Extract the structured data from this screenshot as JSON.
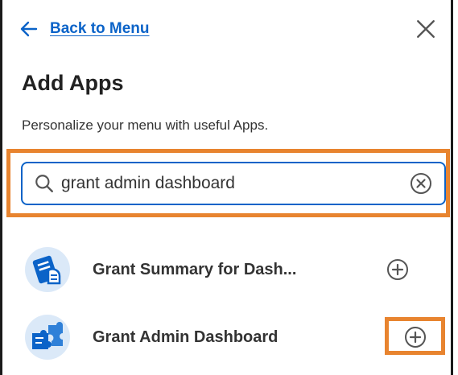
{
  "header": {
    "back_label": "Back to Menu",
    "back_icon": "arrow-left-icon",
    "close_icon": "close-icon"
  },
  "title": "Add Apps",
  "subtitle": "Personalize your menu with useful Apps.",
  "search": {
    "value": "grant admin dashboard",
    "icon": "search-icon",
    "clear_icon": "clear-circle-x-icon"
  },
  "apps": [
    {
      "label": "Grant Summary for Dash...",
      "icon": "hand-document-icon",
      "action_icon": "add-circle-icon"
    },
    {
      "label": "Grant Admin Dashboard",
      "icon": "puzzle-pieces-icon",
      "action_icon": "add-circle-icon"
    }
  ],
  "colors": {
    "accent": "#0b63c8",
    "highlight": "#e8842f",
    "text": "#333333",
    "icon_bg": "#dbe9f8"
  }
}
